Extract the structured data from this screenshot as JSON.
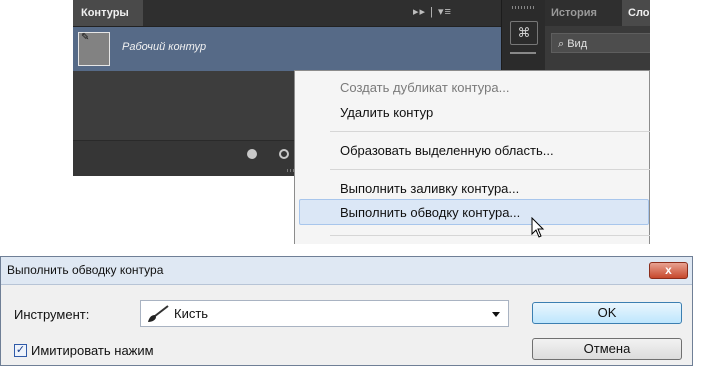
{
  "paths_panel": {
    "tab_label": "Контуры",
    "path_name": "Рабочий контур"
  },
  "right_panel": {
    "tab_history": "История",
    "tab_layers": "Сло",
    "search_label": "Вид"
  },
  "context_menu": {
    "items": [
      {
        "label": "Создать дубликат контура...",
        "enabled": false
      },
      {
        "label": "Удалить контур",
        "enabled": true
      },
      {
        "label": "Образовать выделенную область...",
        "enabled": true
      },
      {
        "label": "Выполнить заливку контура...",
        "enabled": true
      },
      {
        "label": "Выполнить обводку контура...",
        "enabled": true,
        "highlighted": true
      }
    ]
  },
  "dialog": {
    "title": "Выполнить обводку контура",
    "tool_label": "Инструмент:",
    "tool_value": "Кисть",
    "simulate_label": "Имитировать нажим",
    "simulate_checked": true,
    "ok_label": "OK",
    "cancel_label": "Отмена",
    "close_label": "x"
  },
  "colors": {
    "panel_bg": "#3d3d3d",
    "selected_row": "#566a87",
    "menu_highlight": "#dbe7f6",
    "close_button": "#c7482c"
  }
}
